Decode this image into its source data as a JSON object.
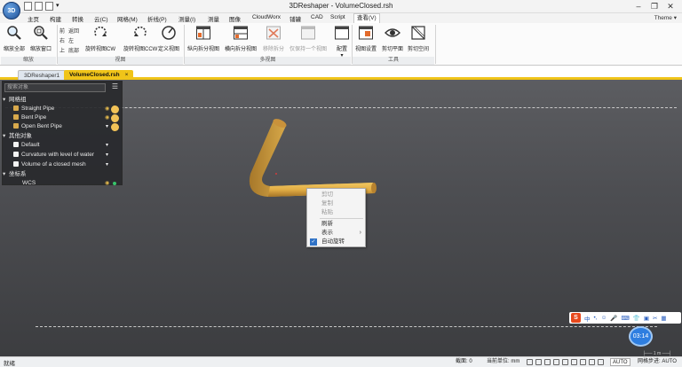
{
  "app": {
    "logo_text": "3D",
    "window_title": "3DReshaper - VolumeClosed.rsh",
    "theme_label": "Theme"
  },
  "menu": {
    "items": [
      "主页",
      "构建",
      "转换",
      "云(C)",
      "网格(M)",
      "折线(P)",
      "测量(I)",
      "测量",
      "图像",
      "CloudWorx",
      "铺罐",
      "CAD",
      "Script",
      "查看(V)"
    ],
    "active_index": 13
  },
  "ribbon": {
    "zoom_all": "缩放全部",
    "zoom_window": "缩放窗口",
    "view_small": {
      "front": "前",
      "back": "返回",
      "right": "右",
      "left": "左",
      "top": "上",
      "bottom": "底部"
    },
    "rotate_cw": "旋转视图CW",
    "rotate_ccw": "旋转视图CCW",
    "define_view": "定义视图",
    "split_vertical": "纵向拆分视图",
    "split_horizontal": "横向拆分视图",
    "remove_split": "移除拆分",
    "keep_one_view": "仅保持一个视图",
    "layout": "配置",
    "view_settings": "视图设置",
    "clip_plane": "剪切平面",
    "clip_space": "剪切空间",
    "groups": {
      "zoom": "缩放",
      "view": "视图",
      "multi_view": "多视图",
      "tools": "工具"
    }
  },
  "tabs": [
    {
      "label": "3DReshaper1"
    },
    {
      "label": "VolumeClosed.rsh",
      "close": "×"
    }
  ],
  "tree": {
    "search_placeholder": "搜索对象",
    "menu_icon": "☰",
    "groups": [
      {
        "label": "网格组",
        "items": [
          "Straight Pipe",
          "Bent Pipe",
          "Open Bent Pipe"
        ]
      },
      {
        "label": "其他对象",
        "items": [
          "Default",
          "Curvature with level of water",
          "Volume of a closed mesh"
        ]
      },
      {
        "label": "坐标系",
        "items": [
          "WCS"
        ]
      }
    ]
  },
  "context_menu": {
    "items": [
      {
        "label": "剪切",
        "enabled": false
      },
      {
        "label": "复制",
        "enabled": false
      },
      {
        "label": "粘贴",
        "enabled": false
      },
      {
        "label": "刷新",
        "enabled": true
      },
      {
        "label": "表示",
        "enabled": true,
        "submenu": true
      },
      {
        "label": "自动旋转",
        "enabled": true,
        "checked": true
      }
    ]
  },
  "ime": {
    "logo": "S",
    "lang": "中",
    "glyphs": [
      "•,",
      "☺",
      "🎤",
      "⌨",
      "👕",
      "▣",
      "✂",
      "▦"
    ]
  },
  "clock": {
    "time": "03:14"
  },
  "scale_bar": {
    "label": "1 m"
  },
  "status": {
    "ready": "就绪",
    "cells": [
      "截面: 0",
      "当前单位: mm",
      "AUTO",
      "网格步进: AUTO"
    ]
  },
  "colors": {
    "accent": "#f0c419",
    "pipe": "#e8b84a",
    "viewport_bg": "#4d4e52"
  }
}
